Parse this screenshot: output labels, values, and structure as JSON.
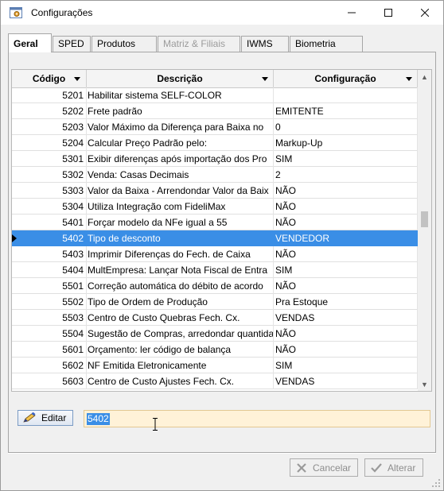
{
  "window": {
    "title": "Configurações"
  },
  "tabs": [
    {
      "label": "Geral",
      "state": "active"
    },
    {
      "label": "SPED",
      "state": "normal"
    },
    {
      "label": "Produtos",
      "state": "normal"
    },
    {
      "label": "Matriz & Filiais",
      "state": "disabled"
    },
    {
      "label": "IWMS",
      "state": "normal"
    },
    {
      "label": "Biometria",
      "state": "normal"
    }
  ],
  "grid": {
    "columns": [
      "Código",
      "Descrição",
      "Configuração"
    ],
    "selected_code": "5402",
    "rows": [
      {
        "code": "5201",
        "desc": "Habilitar sistema SELF-COLOR",
        "conf": ""
      },
      {
        "code": "5202",
        "desc": "Frete padrão",
        "conf": "EMITENTE"
      },
      {
        "code": "5203",
        "desc": "Valor Máximo da Diferença para Baixa no",
        "conf": "0"
      },
      {
        "code": "5204",
        "desc": "Calcular Preço Padrão pelo:",
        "conf": "Markup-Up"
      },
      {
        "code": "5301",
        "desc": "Exibir diferenças após importação dos Pro",
        "conf": "SIM"
      },
      {
        "code": "5302",
        "desc": "Venda: Casas Decimais",
        "conf": "2"
      },
      {
        "code": "5303",
        "desc": "Valor da Baixa - Arrendondar Valor da Baix",
        "conf": "NÃO"
      },
      {
        "code": "5304",
        "desc": "Utiliza Integração com FideliMax",
        "conf": "NÃO"
      },
      {
        "code": "5401",
        "desc": "Forçar modelo da NFe igual a 55",
        "conf": "NÃO"
      },
      {
        "code": "5402",
        "desc": "Tipo de desconto",
        "conf": "VENDEDOR"
      },
      {
        "code": "5403",
        "desc": "Imprimir Diferenças do Fech. de Caixa",
        "conf": "NÃO"
      },
      {
        "code": "5404",
        "desc": "MultEmpresa: Lançar Nota Fiscal de Entra",
        "conf": "SIM"
      },
      {
        "code": "5501",
        "desc": "Correção automática do débito de acordo",
        "conf": "NÃO"
      },
      {
        "code": "5502",
        "desc": "Tipo de Ordem de Produção",
        "conf": "Pra Estoque"
      },
      {
        "code": "5503",
        "desc": "Centro de Custo Quebras Fech. Cx.",
        "conf": "VENDAS"
      },
      {
        "code": "5504",
        "desc": "Sugestão de Compras, arredondar quantida",
        "conf": "NÃO"
      },
      {
        "code": "5601",
        "desc": "Orçamento: ler código de balança",
        "conf": "NÃO"
      },
      {
        "code": "5602",
        "desc": "NF Emitida Eletronicamente",
        "conf": "SIM"
      },
      {
        "code": "5603",
        "desc": "Centro de Custo Ajustes Fech. Cx.",
        "conf": "VENDAS"
      }
    ]
  },
  "editor": {
    "edit_label": "Editar",
    "code_value": "5402"
  },
  "footer": {
    "cancel_label": "Cancelar",
    "confirm_label": "Alterar"
  },
  "icons": {
    "app": "gear-window-icon",
    "edit": "pencil-icon",
    "cancel": "x-icon",
    "confirm": "check-icon"
  },
  "colors": {
    "selection": "#3a8ee6",
    "edit_field_bg": "#fff2d8",
    "disabled_text": "#8d8d8d"
  }
}
